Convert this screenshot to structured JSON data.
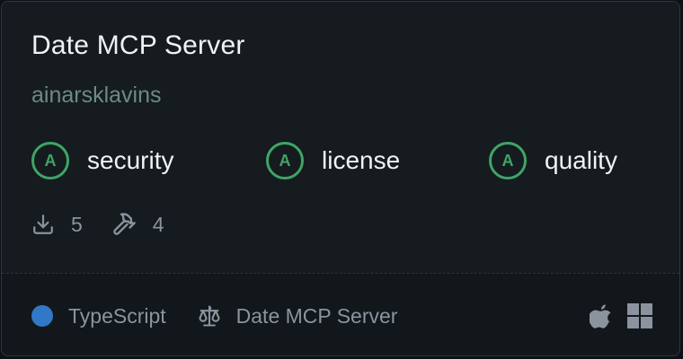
{
  "card": {
    "title": "Date MCP Server",
    "author": "ainarsklavins",
    "grades": [
      {
        "grade": "A",
        "label": "security"
      },
      {
        "grade": "A",
        "label": "license"
      },
      {
        "grade": "A",
        "label": "quality"
      }
    ],
    "stats": {
      "downloads": "5",
      "tools": "4"
    },
    "footer": {
      "language": "TypeScript",
      "language_color": "#3178c6",
      "license": "Date MCP Server",
      "platforms": [
        "apple-icon",
        "windows-icon"
      ]
    },
    "colors": {
      "grade_accent": "#3fa466",
      "background": "#151b1f"
    }
  }
}
